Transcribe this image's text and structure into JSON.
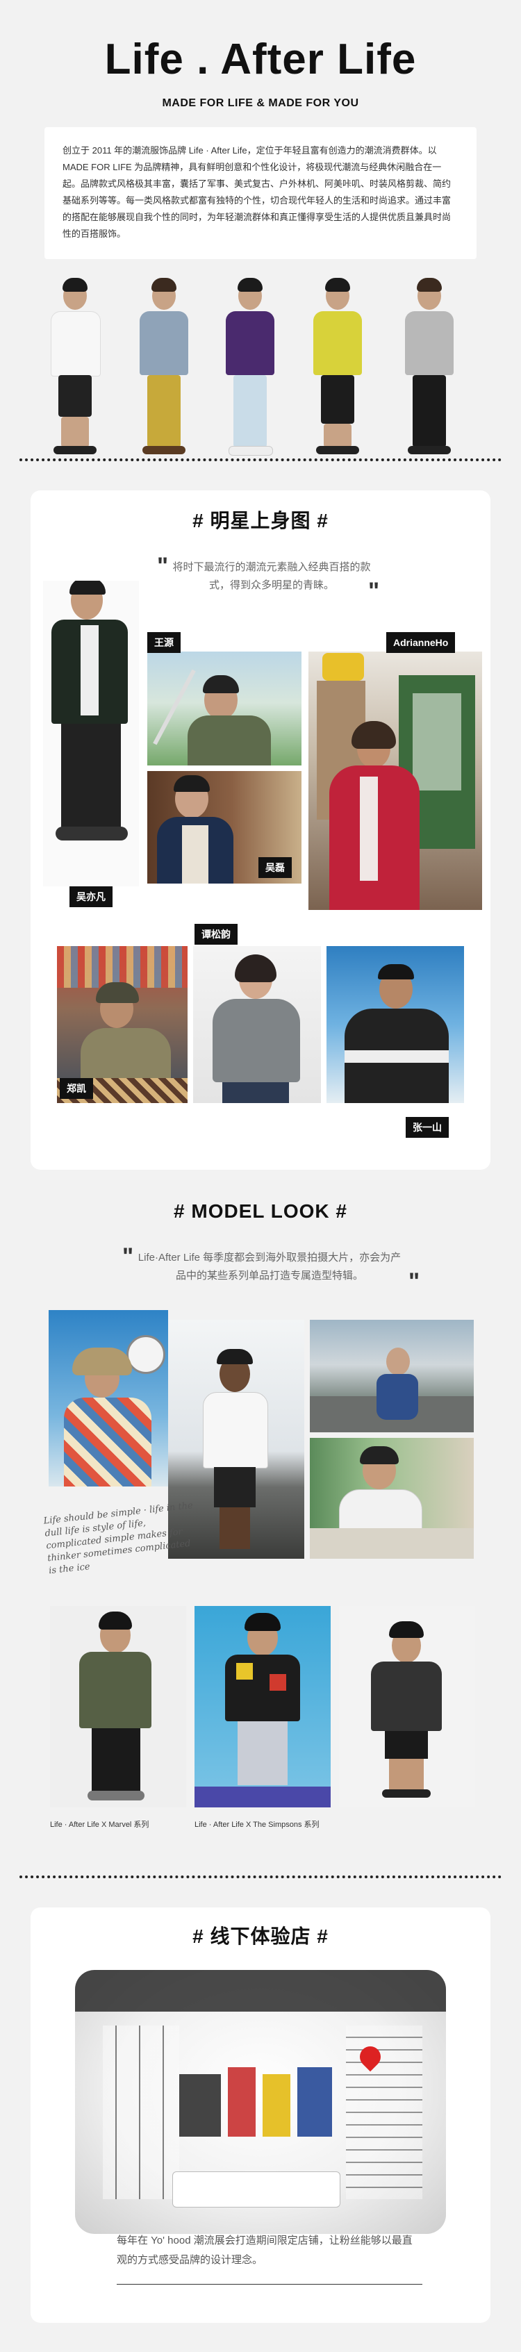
{
  "header": {
    "title": "Life . After Life",
    "subtitle": "MADE FOR LIFE & MADE FOR YOU",
    "intro": "创立于 2011 年的潮流服饰品牌 Life · After Life，定位于年轻且富有创造力的潮流消费群体。以 MADE FOR LIFE 为品牌精神，具有鲜明创意和个性化设计，将极现代潮流与经典休闲融合在一起。品牌款式风格极其丰富，囊括了军事、美式复古、户外林机、阿美咔叽、时装风格剪裁、简约基础系列等等。每一类风格款式都富有独特的个性，切合现代年轻人的生活和时尚追求。通过丰富的搭配在能够展现自我个性的同时，为年轻潮流群体和真正懂得享受生活的人提供优质且兼具时尚性的百搭服饰。"
  },
  "celebrity": {
    "title": "# 明星上身图 #",
    "quote": "将时下最流行的潮流元素融入经典百搭的款式，得到众多明星的青睐。",
    "names": [
      "王源",
      "AdrianneHo",
      "吴亦凡",
      "吴磊",
      "谭松韵",
      "郑凯",
      "张一山"
    ]
  },
  "model_look": {
    "title": "# MODEL LOOK #",
    "quote": "Life·After Life 每季度都会到海外取景拍摄大片，亦会为产品中的某些系列单品打造专属造型特辑。",
    "scribble": "Life should be simple · life in the dull life is style of life, complicated simple makes for thinker sometimes complicated is the ice",
    "captions": [
      "Life · After Life X Marvel 系列",
      "Life · After Life X The Simpsons 系列"
    ]
  },
  "store": {
    "title": "# 线下体验店 #",
    "text": "每年在 Yo' hood 潮流展会打造期间限定店铺，让粉丝能够以最直观的方式感受品牌的设计理念。"
  },
  "colors": {
    "background": "#f2f2f2",
    "card": "#ffffff",
    "tag": "#111111"
  }
}
